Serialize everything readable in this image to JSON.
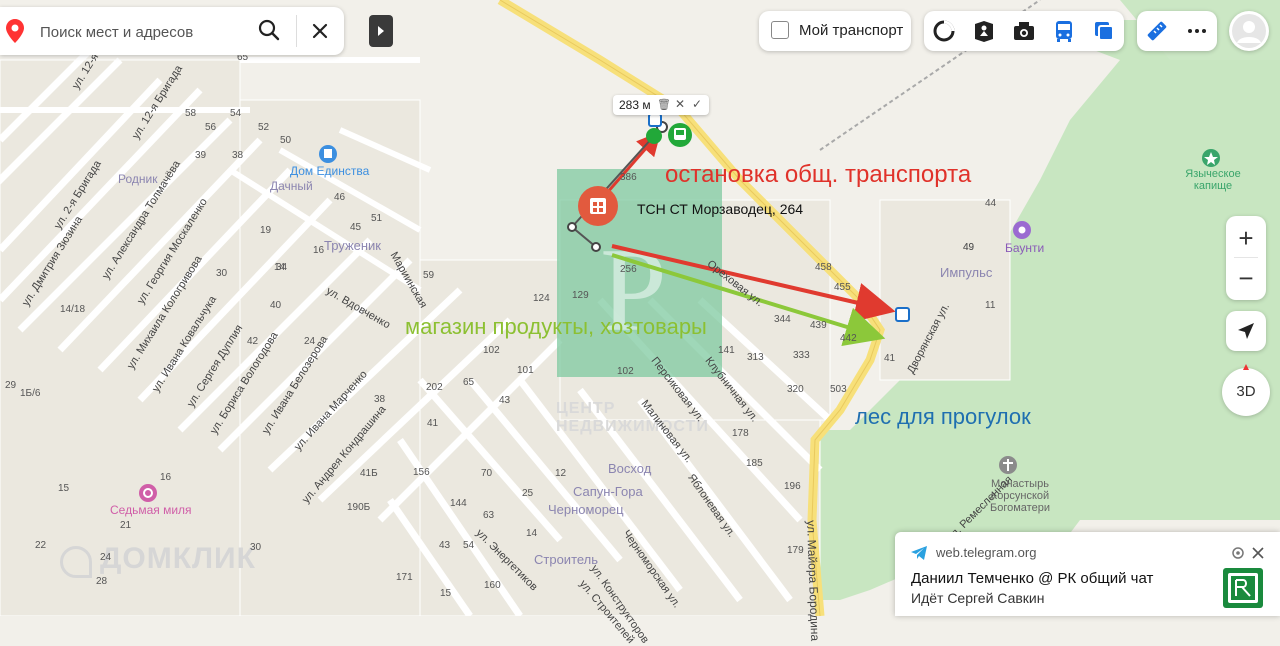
{
  "search": {
    "placeholder": "Поиск мест и адресов"
  },
  "header": {
    "my_transport_label": "Мой транспорт"
  },
  "controls": {
    "zoom_in": "+",
    "zoom_out": "−",
    "three_d_label": "3D"
  },
  "ruler": {
    "distance": "283 м"
  },
  "map": {
    "place_labels": [
      "Дом Единства",
      "Родник",
      "Дачный",
      "Труженик",
      "Импульс",
      "Баунти",
      "Языческое капище",
      "Восход",
      "Сапун-Гора",
      "Черноморец",
      "Строитель",
      "Седьмая миля",
      "Монастырь Корсунской Богоматери"
    ],
    "poi_label": "ТСН СТ Морзаводец, 264",
    "annotations": {
      "stop": "остановка общ. транспорта",
      "shop": "магазин продукты, хозтовары",
      "forest": "лес для прогулок"
    },
    "watermark": "ЦЕНТР НЕДВИЖИМОСТИ",
    "domclick": "ДОМКЛИК",
    "streets": [
      "ул. 12-я Бригада",
      "ул. 12-я Бригада",
      "ул. 2-я Бригада",
      "ул. Дмитрия Зюзина",
      "ул. Александра Толмачёва",
      "ул. Георгия Москаленко",
      "ул. Михаила Кологривова",
      "ул. Ивана Ковальчука",
      "ул. Сергея Дуплия",
      "ул. Бориса Вологодова",
      "ул. Ивана Белозерова",
      "ул. Ивана Марченко",
      "ул. Вдовченко",
      "ул. Андрея Кондрашина",
      "Мариинская",
      "Ореховая ул.",
      "Персиковая ул.",
      "Клубничная ул.",
      "Малиновая ул.",
      "Яблоневая ул.",
      "Черноморская ул.",
      "ул. Энергетиков",
      "ул. Конструкторов",
      "ул. Строителей",
      "ул. Майора Бородина",
      "Дворянская ул.",
      "ул. Ремесленная"
    ],
    "house_numbers": [
      "65",
      "54",
      "52",
      "50",
      "58",
      "56",
      "39",
      "38",
      "46",
      "51",
      "45",
      "19",
      "16",
      "14",
      "30",
      "34",
      "14/18",
      "40",
      "24",
      "42",
      "29",
      "38",
      "1Б/6",
      "15",
      "16",
      "30",
      "28",
      "49",
      "59",
      "124",
      "129",
      "386",
      "256",
      "102",
      "101",
      "102",
      "202",
      "65",
      "43",
      "41",
      "41Б",
      "156",
      "144",
      "190Б",
      "171",
      "160",
      "70",
      "63",
      "25",
      "12",
      "14",
      "54",
      "43",
      "141",
      "313",
      "333",
      "320",
      "344",
      "439",
      "442",
      "458",
      "455",
      "503",
      "178",
      "185",
      "196",
      "179",
      "44",
      "49",
      "41",
      "11",
      "15",
      "22",
      "24",
      "21"
    ]
  },
  "notification": {
    "site": "web.telegram.org",
    "title": "Даниил Темченко @ РК общий чат",
    "body": "Идёт Сергей Савкин"
  },
  "colors": {
    "arrow_red": "#e03a2f",
    "arrow_green": "#8cc83a",
    "annotation_red": "#e0322a",
    "annotation_green": "#8cc032",
    "annotation_blue": "#1f6fb0",
    "forest": "#c7e5c0",
    "square": "#7fc9a0",
    "road_yellow": "#f7e07a",
    "label_purple": "#8a5bb8"
  }
}
